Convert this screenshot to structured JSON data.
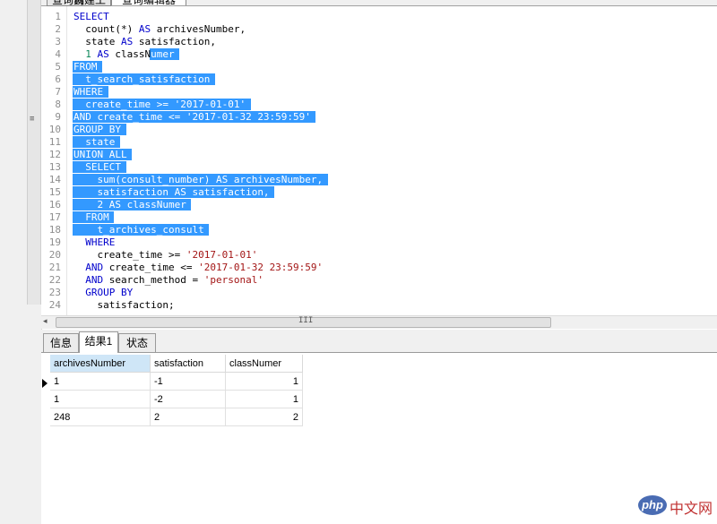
{
  "top_tabs": [
    "查询创建工具",
    "查询编辑器"
  ],
  "editor": {
    "lines": [
      {
        "n": "1",
        "text": "SELECT"
      },
      {
        "n": "2",
        "text": "  count(*) AS archivesNumber,"
      },
      {
        "n": "3",
        "text": "  state AS satisfaction,"
      },
      {
        "n": "4",
        "text": "  1 AS classNumer"
      },
      {
        "n": "5",
        "text": "FROM"
      },
      {
        "n": "6",
        "text": "  t_search_satisfaction"
      },
      {
        "n": "7",
        "text": "WHERE"
      },
      {
        "n": "8",
        "text": "  create_time >= '2017-01-01'"
      },
      {
        "n": "9",
        "text": "AND create_time <= '2017-01-32 23:59:59'"
      },
      {
        "n": "10",
        "text": "GROUP BY"
      },
      {
        "n": "11",
        "text": "  state"
      },
      {
        "n": "12",
        "text": "UNION ALL"
      },
      {
        "n": "13",
        "text": "  SELECT"
      },
      {
        "n": "14",
        "text": "    sum(consult_number) AS archivesNumber,"
      },
      {
        "n": "15",
        "text": "    satisfaction AS satisfaction,"
      },
      {
        "n": "16",
        "text": "    2 AS classNumer"
      },
      {
        "n": "17",
        "text": "  FROM"
      },
      {
        "n": "18",
        "text": "    t_archives_consult"
      },
      {
        "n": "19",
        "text": "  WHERE"
      },
      {
        "n": "20",
        "text": "    create_time >= '2017-01-01'"
      },
      {
        "n": "21",
        "text": "  AND create_time <= '2017-01-32 23:59:59'"
      },
      {
        "n": "22",
        "text": "  AND search_method = 'personal'"
      },
      {
        "n": "23",
        "text": "  GROUP BY"
      },
      {
        "n": "24",
        "text": "    satisfaction;"
      }
    ]
  },
  "scrollbar": {
    "left_arrow": "◂",
    "grip": "III"
  },
  "splitter_grip": "≡",
  "result_tabs": [
    "信息",
    "结果1",
    "状态"
  ],
  "result_grid": {
    "columns": [
      "archivesNumber",
      "satisfaction",
      "classNumer"
    ],
    "rows": [
      [
        "1",
        "-1",
        "1"
      ],
      [
        "1",
        "-2",
        "1"
      ],
      [
        "248",
        "2",
        "2"
      ]
    ]
  },
  "watermark": {
    "badge": "php",
    "text": "中文网"
  }
}
